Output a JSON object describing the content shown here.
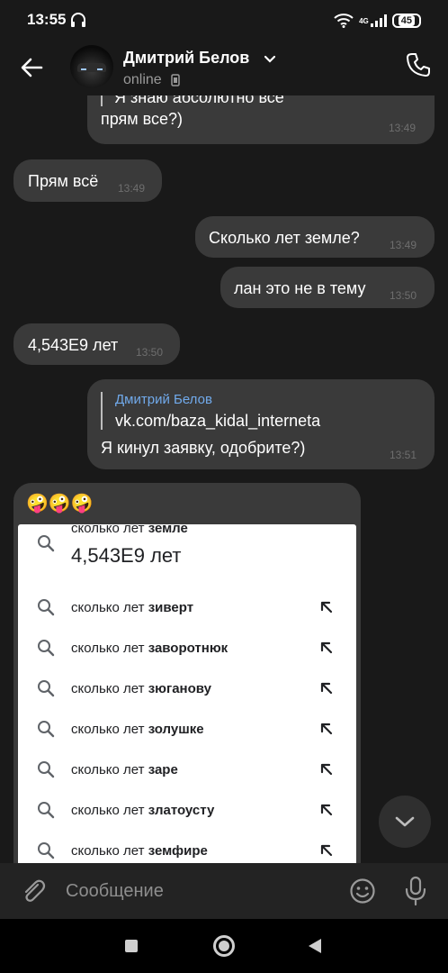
{
  "status": {
    "time": "13:55",
    "network": "4G",
    "battery": "45"
  },
  "header": {
    "name": "Дмитрий Белов",
    "presence": "online"
  },
  "messages": {
    "m0_text1": "Я знаю абсолютно все",
    "m0_text2": "прям все?)",
    "m0_time": "13:49",
    "m1_text": "Прям всё",
    "m1_time": "13:49",
    "m2_text": "Сколько лет земле?",
    "m2_time": "13:49",
    "m3_text": "лан это не в тему",
    "m3_time": "13:50",
    "m4_text": "4,543E9 лет",
    "m4_time": "13:50",
    "m5_quote_name": "Дмитрий Белов",
    "m5_quote_text": "vk.com/baza_kidal_interneta",
    "m5_text": "Я кинул заявку, одобрите?)",
    "m5_time": "13:51",
    "m6_emoji": "🤪🤪🤪"
  },
  "search": {
    "query_prefix": "сколько лет ",
    "query_bold": "земле",
    "answer": "4,543E9 лет",
    "suggestions": [
      {
        "prefix": "сколько лет ",
        "bold": "зиверт"
      },
      {
        "prefix": "сколько лет ",
        "bold": "заворотнюк"
      },
      {
        "prefix": "сколько лет ",
        "bold": "зюганову"
      },
      {
        "prefix": "сколько лет ",
        "bold": "золушке"
      },
      {
        "prefix": "сколько лет ",
        "bold": "заре"
      },
      {
        "prefix": "сколько лет ",
        "bold": "златоусту"
      },
      {
        "prefix": "сколько лет ",
        "bold": "земфире"
      }
    ]
  },
  "composer": {
    "placeholder": "Сообщение"
  },
  "colors": {
    "bubble": "#3a3a3a",
    "background": "#191919",
    "link": "#71aaeb"
  }
}
